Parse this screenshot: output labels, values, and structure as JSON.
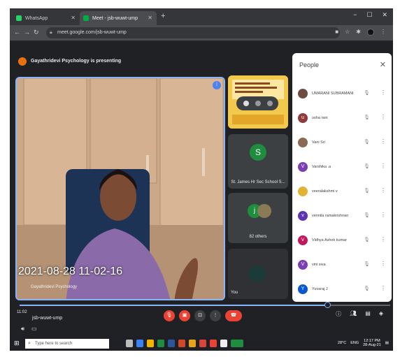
{
  "browser": {
    "tabs": [
      {
        "label": "WhatsApp",
        "fav_color": "#25d366"
      },
      {
        "label": "Meet - jsb-wuwt-ump",
        "fav_color": "#00ac47"
      }
    ],
    "new_tab": "+",
    "window_controls": [
      "−",
      "☐",
      "✕"
    ],
    "url": "meet.google.com/jsb-wuwt-ump"
  },
  "meeting": {
    "presenting_banner": "Gayathridevi Psychology is presenting",
    "timestamp_overlay": "2021-08-28 11-02-16",
    "main_speaker_name": "Gayathridevi Psychology",
    "tiles": [
      {
        "initial": "S",
        "label": "St. James Hr Sec School S...",
        "color": "#1e8e3e"
      },
      {
        "initial": "j",
        "label": "82 others",
        "color": "#1e8e3e"
      },
      {
        "label": "You"
      }
    ],
    "meeting_code": "jsb-wuwt-ump",
    "clock_left": "11:02",
    "progress_fraction": 0.83
  },
  "people_panel": {
    "title": "People",
    "close": "✕",
    "participants": [
      {
        "name": "UMARANI SUBRAMANI",
        "initial": "",
        "color": "#6d4c41"
      },
      {
        "name": "usha rani",
        "initial": "u",
        "color": "#8d3b3b"
      },
      {
        "name": "Vani Sri",
        "initial": "",
        "color": "#8a6a55"
      },
      {
        "name": "Varshika .a",
        "initial": "V",
        "color": "#7b3fb4"
      },
      {
        "name": "veeralakshmi v",
        "initial": "",
        "color": "#e2b233"
      },
      {
        "name": "vennila ramakrishnan",
        "initial": "v",
        "color": "#5e35b1"
      },
      {
        "name": "Vidhya Ashok kumar",
        "initial": "V",
        "color": "#c2185b"
      },
      {
        "name": "vini siva",
        "initial": "V",
        "color": "#7b3fb4"
      },
      {
        "name": "Yuvaraj J",
        "initial": "Y",
        "color": "#0b57d0"
      }
    ]
  },
  "taskbar": {
    "search_placeholder": "Type here to search",
    "temperature": "28°C",
    "lang": "ENG",
    "time": "12:17 PM",
    "date": "28-Aug-21"
  }
}
